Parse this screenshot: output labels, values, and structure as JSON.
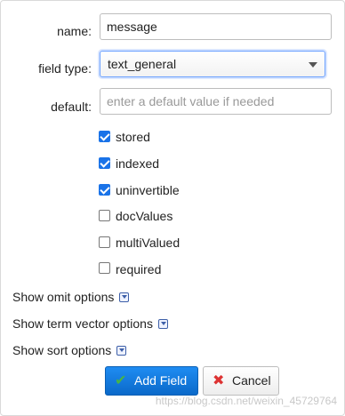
{
  "form": {
    "name_label": "name:",
    "name_value": "message",
    "field_type_label": "field type:",
    "field_type_value": "text_general",
    "default_label": "default:",
    "default_placeholder": "enter a default value if needed"
  },
  "options": [
    {
      "label": "stored",
      "checked": true
    },
    {
      "label": "indexed",
      "checked": true
    },
    {
      "label": "uninvertible",
      "checked": true
    },
    {
      "label": "docValues",
      "checked": false
    },
    {
      "label": "multiValued",
      "checked": false
    },
    {
      "label": "required",
      "checked": false
    }
  ],
  "toggles": {
    "omit": "Show omit options",
    "term_vector": "Show term vector options",
    "sort": "Show sort options"
  },
  "buttons": {
    "add": "Add Field",
    "cancel": "Cancel"
  },
  "watermark": "https://blog.csdn.net/weixin_45729764",
  "colors": {
    "accent": "#1a73e8",
    "add_button": "#1478dc",
    "cancel_icon": "#dd3333",
    "add_icon": "#47b447"
  },
  "icons": {
    "add": "check-icon",
    "cancel": "x-icon",
    "toggle": "chevron-down-icon"
  }
}
